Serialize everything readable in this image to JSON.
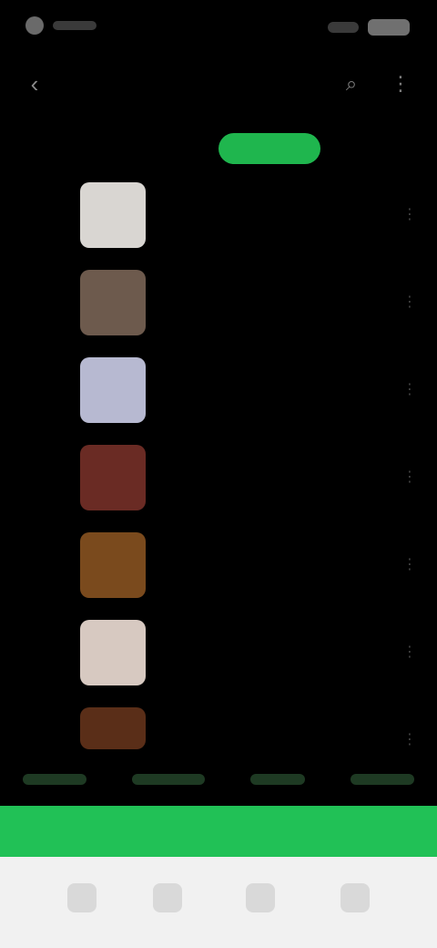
{
  "status_bar": {
    "time": "",
    "right": ""
  },
  "top_bar": {
    "title": ""
  },
  "tabs": [
    {
      "label": "",
      "active": false
    },
    {
      "label": "",
      "active": false
    },
    {
      "label": "",
      "active": true
    },
    {
      "label": "",
      "active": false
    }
  ],
  "tracks": [
    {
      "rank": "",
      "title": "",
      "thumb_color": "#d9d6d2"
    },
    {
      "rank": "",
      "title": "",
      "thumb_color": "#6d5a4d"
    },
    {
      "rank": "",
      "title": "",
      "thumb_color": "#b7b9d1"
    },
    {
      "rank": "",
      "title": "",
      "thumb_color": "#6a2b24"
    },
    {
      "rank": "",
      "title": "",
      "thumb_color": "#7a4a1d"
    },
    {
      "rank": "",
      "title": "",
      "thumb_color": "#d7c9c1"
    },
    {
      "rank": "",
      "title": "",
      "thumb_color": "#5a2e18"
    }
  ],
  "play_bar": {
    "label": ""
  },
  "bottom_nav": [
    {
      "label": ""
    },
    {
      "label": ""
    },
    {
      "label": ""
    },
    {
      "label": ""
    }
  ],
  "colors": {
    "accent_green": "#21c156",
    "background": "#000000",
    "bottom_nav_bg": "#f1f1f1"
  }
}
